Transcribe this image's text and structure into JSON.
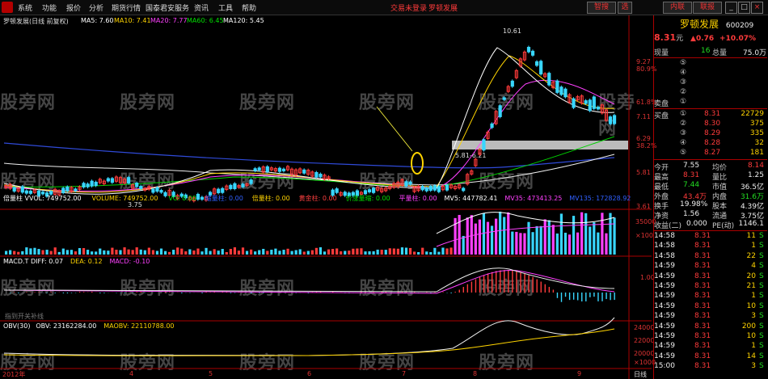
{
  "menu": [
    "系统",
    "功能",
    "报价",
    "分析",
    "期货行情",
    "国泰君安服务",
    "资讯",
    "工具",
    "帮助"
  ],
  "top_center": {
    "login": "交易未登录",
    "stock": "罗顿发展"
  },
  "top_buttons": [
    "智搜",
    "选",
    "内联",
    "资金",
    "联报"
  ],
  "watermark": "股旁网",
  "chart": {
    "title": "罗顿发展(日线 前复权)",
    "ma": [
      {
        "label": "MA5: 7.60",
        "color": "#ffffff"
      },
      {
        "label": "MA10: 7.41",
        "color": "#ffd400"
      },
      {
        "label": "MA20: 7.77",
        "color": "#ff40ff"
      },
      {
        "label": "MA60: 6.45",
        "color": "#00e000"
      },
      {
        "label": "MA120: 5.45",
        "color": "#ffffff"
      }
    ],
    "price_ticks": [
      "9.27",
      "80.9%",
      "61.8%",
      "7.11",
      "6.29",
      "38.2%",
      "5.81",
      "3.61"
    ],
    "annotations": {
      "high": "10.61",
      "low": "3.75",
      "range": "5.81-6.21"
    },
    "volume_header": [
      {
        "label": "倍量柱 VVOL: 749752.00",
        "color": "#ffffff"
      },
      {
        "label": "VOLUME: 749752.00",
        "color": "#ffd400"
      },
      {
        "label": "VO: 0.00",
        "color": "#00e000"
      },
      {
        "label": "缩量柱: 0.00",
        "color": "#3060ff"
      },
      {
        "label": "倍量柱: 0.00",
        "color": "#ffd400"
      },
      {
        "label": "黄金柱: 0.00",
        "color": "#ff4040"
      },
      {
        "label": "价涨量缩: 0.00",
        "color": "#00e000"
      },
      {
        "label": "平量柱: 0.00",
        "color": "#ff40ff"
      },
      {
        "label": "MV5: 447782.41",
        "color": "#ffffff"
      },
      {
        "label": "MV35: 473413.25",
        "color": "#ff40ff"
      },
      {
        "label": "MV135: 172828.92",
        "color": "#3060ff"
      }
    ],
    "vol_ticks": [
      "35000",
      "×100"
    ],
    "macd_header": [
      {
        "label": "MACD.T DIFF: 0.07",
        "color": "#ffffff"
      },
      {
        "label": "DEA: 0.12",
        "color": "#ffd400"
      },
      {
        "label": "MACD: -0.10",
        "color": "#ff40ff"
      }
    ],
    "macd_tick": "1.00",
    "macd_note": "指到开关补线",
    "obv_header": [
      {
        "label": "OBV(30)",
        "color": "#ffffff"
      },
      {
        "label": "OBV: 23162284.00",
        "color": "#ffffff"
      },
      {
        "label": "MAOBV: 22110788.00",
        "color": "#ffd400"
      }
    ],
    "obv_ticks": [
      "24000",
      "22000",
      "20000",
      "×1000"
    ],
    "dates": [
      "2012年",
      "4",
      "5",
      "6",
      "7",
      "8",
      "9"
    ],
    "period": "日线"
  },
  "panel": {
    "name": "罗顿发展",
    "code": "600209",
    "price": "8.31",
    "unit": "元",
    "change": "▲0.76",
    "pct": "+10.07%",
    "now_label": "现量",
    "now_val": "16",
    "total_label": "总量",
    "total_val": "75.0万",
    "sell_label": "卖盘",
    "sell_levels": [
      "⑤",
      "④",
      "③",
      "②",
      "①"
    ],
    "buy_label": "买盘",
    "buy_levels": [
      {
        "n": "①",
        "p": "8.31",
        "v": "22729"
      },
      {
        "n": "②",
        "p": "8.30",
        "v": "375"
      },
      {
        "n": "③",
        "p": "8.29",
        "v": "335"
      },
      {
        "n": "④",
        "p": "8.28",
        "v": "32"
      },
      {
        "n": "⑤",
        "p": "8.27",
        "v": "181"
      }
    ],
    "stats": [
      {
        "k": "今开",
        "v": "7.55",
        "k2": "均价",
        "v2": "8.14"
      },
      {
        "k": "最高",
        "v": "8.31",
        "k2": "量比",
        "v2": "1.25"
      },
      {
        "k": "最低",
        "v": "7.44",
        "k2": "市值",
        "v2": "36.5亿"
      },
      {
        "k": "外盘",
        "v": "43.4万",
        "k2": "内盘",
        "v2": "31.6万"
      },
      {
        "k": "换手",
        "v": "19.98%",
        "k2": "股本",
        "v2": "4.39亿"
      },
      {
        "k": "净资",
        "v": "1.56",
        "k2": "流通",
        "v2": "3.75亿"
      },
      {
        "k": "收益(二)",
        "v": "0.000",
        "k2": "PE(动)",
        "v2": "1146.1"
      }
    ],
    "ticks": [
      {
        "t": "14:58",
        "p": "8.31",
        "v": "11",
        "s": "S"
      },
      {
        "t": "14:58",
        "p": "8.31",
        "v": "1",
        "s": "S"
      },
      {
        "t": "14:58",
        "p": "8.31",
        "v": "22",
        "s": "S"
      },
      {
        "t": "14:59",
        "p": "8.31",
        "v": "4",
        "s": "S"
      },
      {
        "t": "14:59",
        "p": "8.31",
        "v": "20",
        "s": "S"
      },
      {
        "t": "14:59",
        "p": "8.31",
        "v": "21",
        "s": "S"
      },
      {
        "t": "14:59",
        "p": "8.31",
        "v": "1",
        "s": "S"
      },
      {
        "t": "14:59",
        "p": "8.31",
        "v": "10",
        "s": "S"
      },
      {
        "t": "14:59",
        "p": "8.31",
        "v": "3",
        "s": "S"
      },
      {
        "t": "14:59",
        "p": "8.31",
        "v": "200",
        "s": "S"
      },
      {
        "t": "14:59",
        "p": "8.31",
        "v": "10",
        "s": "S"
      },
      {
        "t": "14:59",
        "p": "8.31",
        "v": "1",
        "s": "S"
      },
      {
        "t": "14:59",
        "p": "8.31",
        "v": "14",
        "s": "S"
      },
      {
        "t": "15:00",
        "p": "8.31",
        "v": "3",
        "s": "S"
      }
    ],
    "dates": [
      "日线"
    ]
  }
}
